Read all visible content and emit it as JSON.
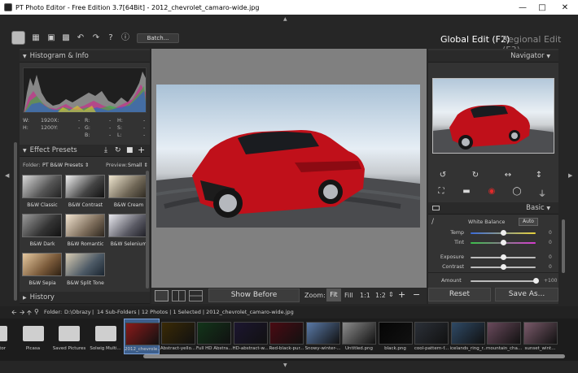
{
  "window": {
    "title": "PT Photo Editor - Free Edition 3.7[64Bit] - 2012_chevrolet_camaro-wide.jpg"
  },
  "toolbar": {
    "batch_label": "Batch...",
    "global_edit": "Global Edit (F2)",
    "regional_edit": "Regional Edit (F3)",
    "icons": [
      "app-logo-icon",
      "open-folder-icon",
      "save-icon",
      "save-as-icon",
      "undo-icon",
      "redo-icon",
      "help-icon",
      "info-icon"
    ]
  },
  "histogram": {
    "title": "Histogram & Info",
    "info": {
      "w_label": "W:",
      "w_value": "1920",
      "h_label": "H:",
      "h_value": "1200",
      "x_label": "X:",
      "y_label": "Y:",
      "r_label": "R:",
      "g_label": "G:",
      "b_label": "B:",
      "h2_label": "H:",
      "s_label": "S:",
      "l_label": "L:",
      "dash": "-"
    }
  },
  "presets": {
    "title": "Effect Presets",
    "folder_label": "Folder:",
    "folder_value": "PT B&W Presets",
    "preview_label": "Preview:",
    "preview_value": "Small",
    "items": [
      "B&W Classic",
      "B&W Contrast",
      "B&W Cream",
      "B&W Dark",
      "B&W Romantic",
      "B&W Selenium",
      "B&W Sepia",
      "B&W Split Tone"
    ]
  },
  "history": {
    "title": "History"
  },
  "viewbar": {
    "show_before": "Show Before",
    "zoom_label": "Zoom:",
    "fit": "Fit",
    "fill": "Fill",
    "one_to_one": "1:1",
    "one_to_two": "1:2",
    "plus": "+",
    "minus": "−"
  },
  "navigator": {
    "title": "Navigator"
  },
  "basic": {
    "title": "Basic",
    "white_balance": "White Balance",
    "auto_label": "Auto",
    "sliders": [
      {
        "label": "Temp",
        "value": "0",
        "level": 0.5
      },
      {
        "label": "Tint",
        "value": "0",
        "level": 0.5
      },
      {
        "label": "Exposure",
        "value": "0",
        "level": 0.5
      },
      {
        "label": "Contrast",
        "value": "0",
        "level": 0.5
      }
    ],
    "amount_label": "Amount",
    "amount_value": "+100",
    "amount_level": 1.0
  },
  "actions": {
    "reset": "Reset",
    "save_as": "Save As..."
  },
  "filmbar": {
    "folder_label": "Folder:",
    "path": "D:\\Obrazy",
    "summary": "14 Sub-Folders | 12 Photos | 1 Selected | 2012_chevrolet_camaro-wide.jpg"
  },
  "filmstrip": {
    "items": [
      {
        "label": "Director",
        "kind": "folder"
      },
      {
        "label": "Picasa",
        "kind": "folder"
      },
      {
        "label": "Saved Pictures",
        "kind": "folder"
      },
      {
        "label": "Solwig Multi...",
        "kind": "folder"
      },
      {
        "label": "2012_chevrole...",
        "kind": "photo",
        "color": "#8a1a1a"
      },
      {
        "label": "Abstract-yello...",
        "kind": "photo",
        "color": "#3a2a05"
      },
      {
        "label": "Full HD Abstra...",
        "kind": "photo",
        "color": "#12351a"
      },
      {
        "label": "HD-abstract-w...",
        "kind": "photo",
        "color": "#1c1630"
      },
      {
        "label": "Red-black-pur...",
        "kind": "photo",
        "color": "#4a0a12"
      },
      {
        "label": "Snowy-winter-...",
        "kind": "photo",
        "color": "#5a7aa8"
      },
      {
        "label": "Untitled.png",
        "kind": "photo",
        "color": "#8c8c8c"
      },
      {
        "label": "black.png",
        "kind": "photo",
        "color": "#050505"
      },
      {
        "label": "cool-pattern-f...",
        "kind": "photo",
        "color": "#2b3038"
      },
      {
        "label": "icelands_ring_r...",
        "kind": "photo",
        "color": "#2f4a66"
      },
      {
        "label": "mountain_cha...",
        "kind": "photo",
        "color": "#6a4a5c"
      },
      {
        "label": "sunset_wint...",
        "kind": "photo",
        "color": "#7a5a6a"
      }
    ]
  }
}
